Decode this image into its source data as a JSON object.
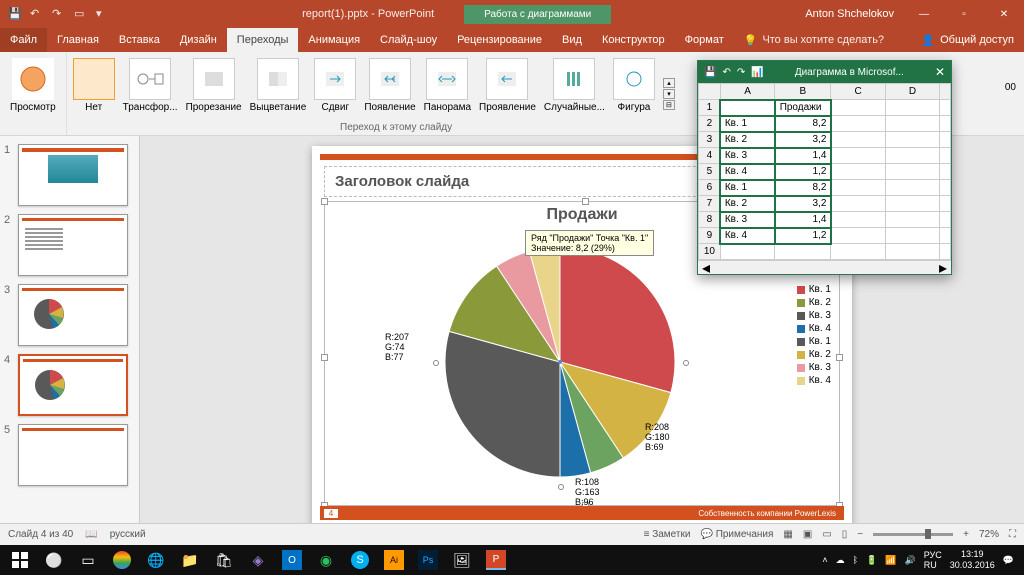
{
  "title": {
    "filename": "report(1).pptx - PowerPoint",
    "chartTools": "Работа с диаграммами",
    "user": "Anton Shchelokov"
  },
  "menu": {
    "file": "Файл",
    "home": "Главная",
    "insert": "Вставка",
    "design": "Дизайн",
    "transitions": "Переходы",
    "animations": "Анимация",
    "slideshow": "Слайд-шоу",
    "review": "Рецензирование",
    "view": "Вид",
    "designer": "Конструктор",
    "format": "Формат",
    "tellMe": "Что вы хотите сделать?",
    "share": "Общий доступ"
  },
  "ribbon": {
    "preview": "Просмотр",
    "none": "Нет",
    "transform": "Трансфор...",
    "cut": "Прорезание",
    "fade": "Выцветание",
    "push": "Сдвиг",
    "appear": "Появление",
    "panorama": "Панорама",
    "reveal": "Проявление",
    "random": "Случайные...",
    "shape": "Фигура",
    "label": "Переход к этому слайду",
    "timingNum": "00"
  },
  "slide": {
    "title": "Заголовок слайда",
    "chartTitle": "Продажи",
    "pageNum": "4",
    "footerText": "Собственность компании PowerLexis"
  },
  "tooltip": {
    "line1": "Ряд \"Продажи\" Точка \"Кв. 1\"",
    "line2": "Значение: 8,2 (29%)"
  },
  "rgbLabels": {
    "r1": "R:207\nG:74\nB:77",
    "r2": "R:208\nG:180\nB:69",
    "r3": "R:108\nG:163\nB:96"
  },
  "legend": [
    "Кв. 1",
    "Кв. 2",
    "Кв. 3",
    "Кв. 4",
    "Кв. 1",
    "Кв. 2",
    "Кв. 3",
    "Кв. 4"
  ],
  "legendColors": [
    "#cf4a4d",
    "#8a9a3a",
    "#595959",
    "#1c6fa8",
    "#595959",
    "#d4b345",
    "#e89aa0",
    "#e8d48a"
  ],
  "excel": {
    "title": "Диаграмма в Microsof...",
    "headers": [
      "",
      "A",
      "B",
      "C",
      "D"
    ],
    "b1": "Продажи",
    "rows": [
      {
        "n": "2",
        "a": "Кв. 1",
        "b": "8,2"
      },
      {
        "n": "3",
        "a": "Кв. 2",
        "b": "3,2"
      },
      {
        "n": "4",
        "a": "Кв. 3",
        "b": "1,4"
      },
      {
        "n": "5",
        "a": "Кв. 4",
        "b": "1,2"
      },
      {
        "n": "6",
        "a": "Кв. 1",
        "b": "8,2"
      },
      {
        "n": "7",
        "a": "Кв. 2",
        "b": "3,2"
      },
      {
        "n": "8",
        "a": "Кв. 3",
        "b": "1,4"
      },
      {
        "n": "9",
        "a": "Кв. 4",
        "b": "1,2"
      }
    ]
  },
  "status": {
    "slide": "Слайд 4 из 40",
    "lang": "русский",
    "notes": "Заметки",
    "comments": "Примечания",
    "zoom": "72%"
  },
  "taskbar": {
    "lang1": "РУС",
    "lang2": "RU",
    "time": "13:19",
    "date": "30.03.2016"
  },
  "chart_data": {
    "type": "pie",
    "title": "Продажи",
    "series": [
      {
        "name": "Продажи",
        "values": [
          8.2,
          3.2,
          1.4,
          1.2,
          8.2,
          3.2,
          1.4,
          1.2
        ]
      }
    ],
    "categories": [
      "Кв. 1",
      "Кв. 2",
      "Кв. 3",
      "Кв. 4",
      "Кв. 1",
      "Кв. 2",
      "Кв. 3",
      "Кв. 4"
    ],
    "colors": [
      "#cf4a4d",
      "#d4b345",
      "#6ca360",
      "#1c6fa8",
      "#595959",
      "#8a9a3a",
      "#e89aa0",
      "#e8d48a"
    ]
  }
}
